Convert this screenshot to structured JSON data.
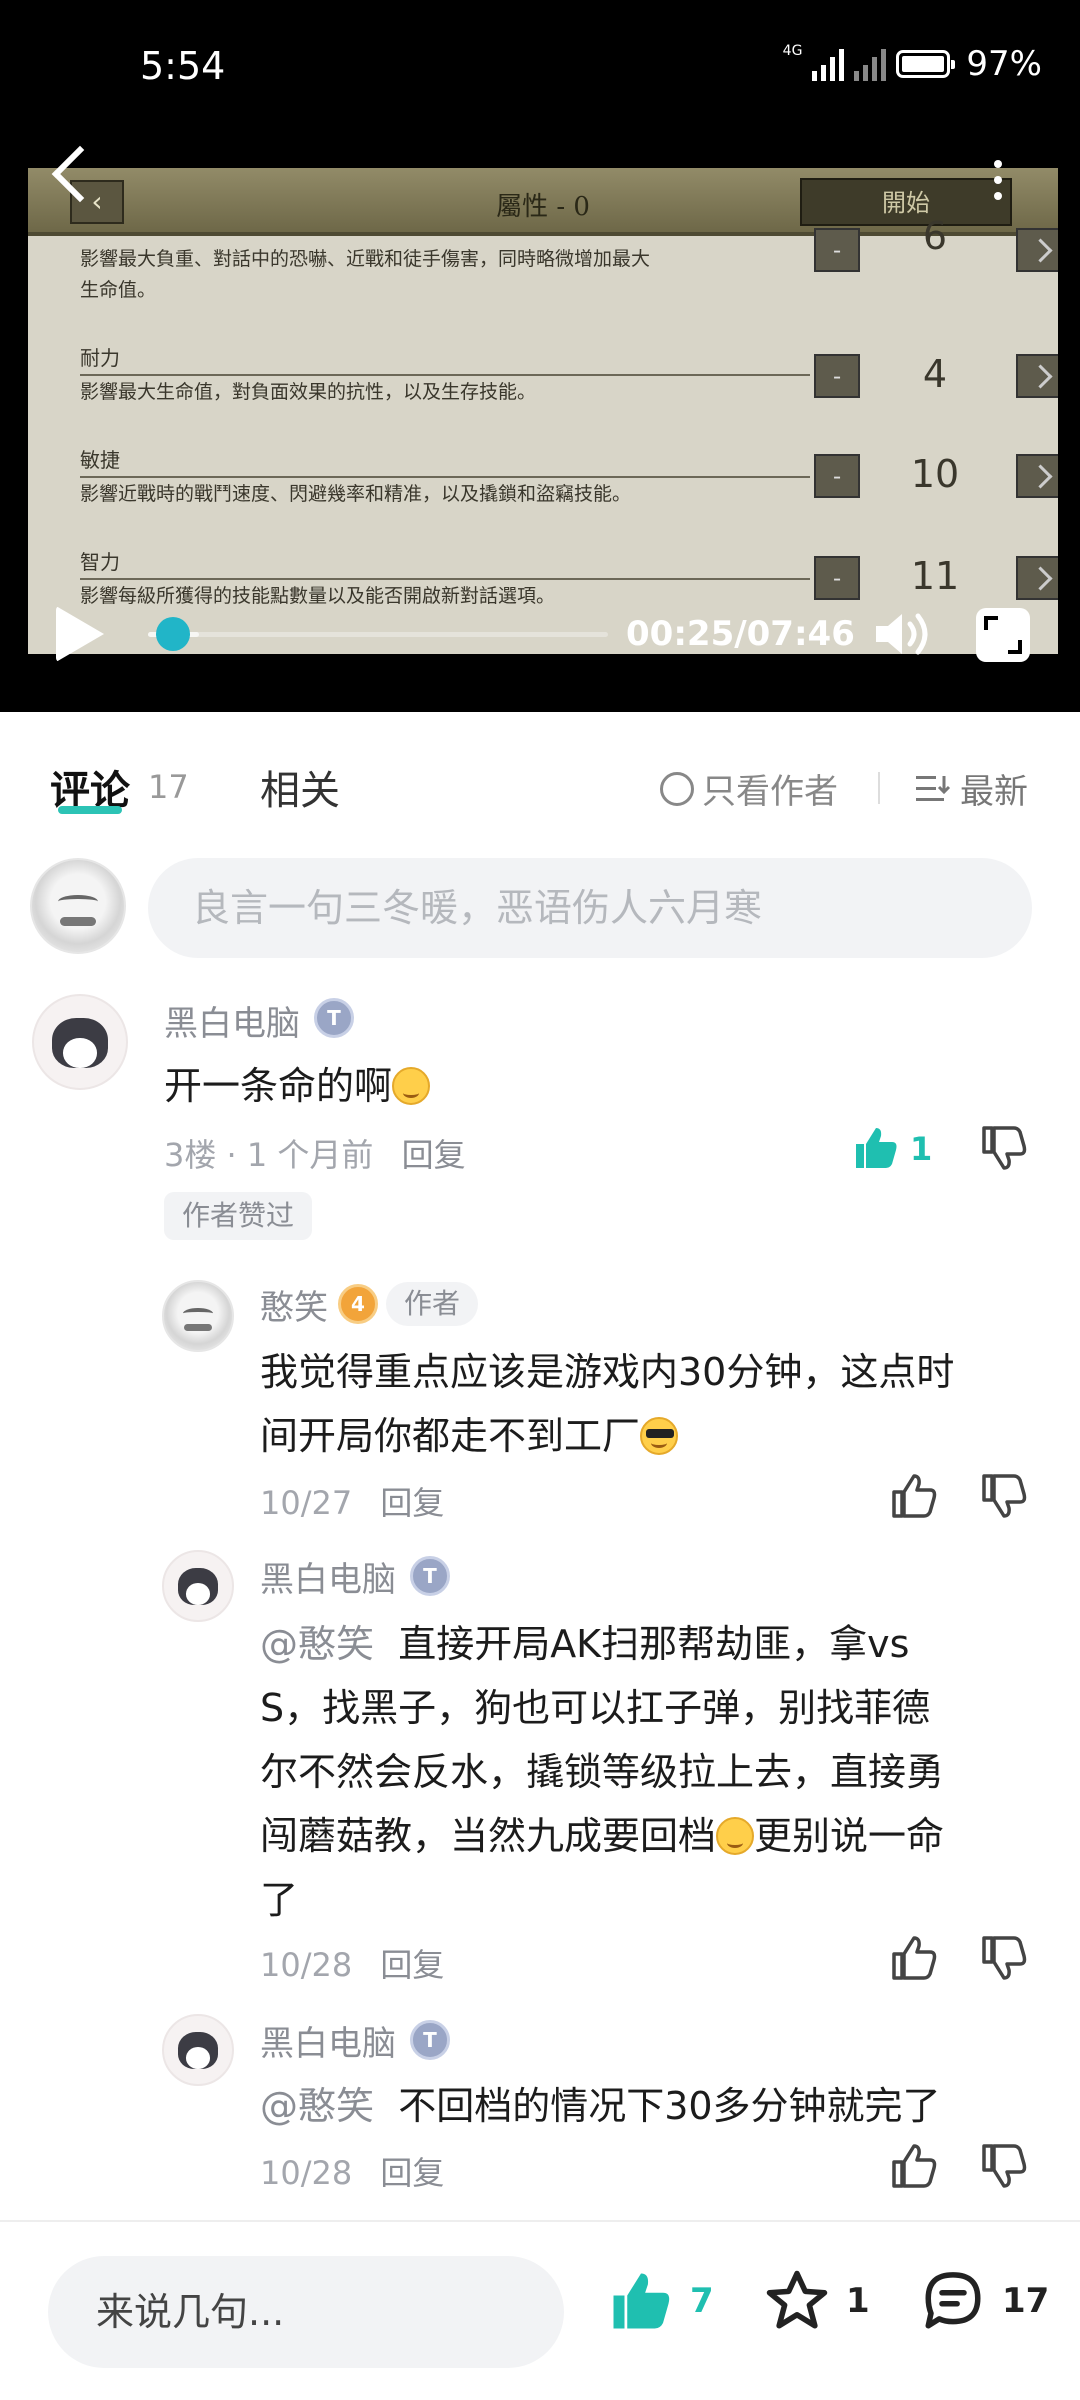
{
  "status_bar": {
    "time": "5:54",
    "network": "4G",
    "battery": "97%"
  },
  "video": {
    "game": {
      "title": "屬性 - 0",
      "start_button": "開始",
      "top_desc": "影響最大負重、對話中的恐嚇、近戰和徒手傷害，同時略微增加最大",
      "top_desc_2": "生命值。",
      "top_value": "6",
      "attributes": [
        {
          "name": "耐力",
          "desc": "影響最大生命值，對負面效果的抗性，以及生存技能。",
          "value": "4"
        },
        {
          "name": "敏捷",
          "desc": "影響近戰時的戰鬥速度、閃避幾率和精准，以及撬鎖和盜竊技能。",
          "value": "10"
        },
        {
          "name": "智力",
          "desc": "影響每級所獲得的技能點數量以及能否開啟新對話選項。",
          "value": "11"
        }
      ],
      "minus": "-"
    },
    "timecode": "00:25/07:46",
    "progress_fraction": 0.055,
    "buffered_fraction": 0.11
  },
  "tabs": {
    "comments_label": "评论",
    "comments_count": "17",
    "related_label": "相关",
    "only_author": "只看作者",
    "sort": "最新"
  },
  "comment_input": {
    "placeholder": "良言一句三冬暖，恶语伤人六月寒"
  },
  "comments": [
    {
      "user": "黑白电脑",
      "level": "T",
      "text": "开一条命的啊",
      "floor": "3楼",
      "time": "1 个月前",
      "reply": "回复",
      "likes": "1",
      "author_liked": "作者赞过"
    }
  ],
  "replies": [
    {
      "user": "憨笑",
      "level": "4",
      "author_tag": "作者",
      "line1": "我觉得重点应该是游戏内30分钟，这点时",
      "line2": "间开局你都走不到工厂",
      "date": "10/27",
      "reply": "回复"
    },
    {
      "user": "黑白电脑",
      "level": "T",
      "mention": "@憨笑",
      "line1": "直接开局AK扫那帮劫匪，拿vs",
      "line2": "S，找黑子，狗也可以扛子弹，别找菲德",
      "line3": "尔不然会反水，撬锁等级拉上去，直接勇",
      "line4a": "闯蘑菇教，当然九成要回档",
      "line4b": "更别说一命",
      "line5": "了",
      "date": "10/28",
      "reply": "回复"
    },
    {
      "user": "黑白电脑",
      "level": "T",
      "mention": "@憨笑",
      "line1": "不回档的情况下30多分钟就完了",
      "date": "10/28",
      "reply": "回复"
    }
  ],
  "bottom_bar": {
    "input_placeholder": "来说几句...",
    "likes": "7",
    "favorites": "1",
    "comments": "17"
  },
  "colors": {
    "accent": "#1fbfb0",
    "muted": "#8a8d94"
  },
  "icons": [
    "back-arrow-icon",
    "more-icon",
    "play-icon",
    "volume-icon",
    "fullscreen-icon",
    "circle-icon",
    "sort-icon",
    "thumb-up-icon",
    "thumb-down-icon",
    "star-icon",
    "comment-icon"
  ]
}
